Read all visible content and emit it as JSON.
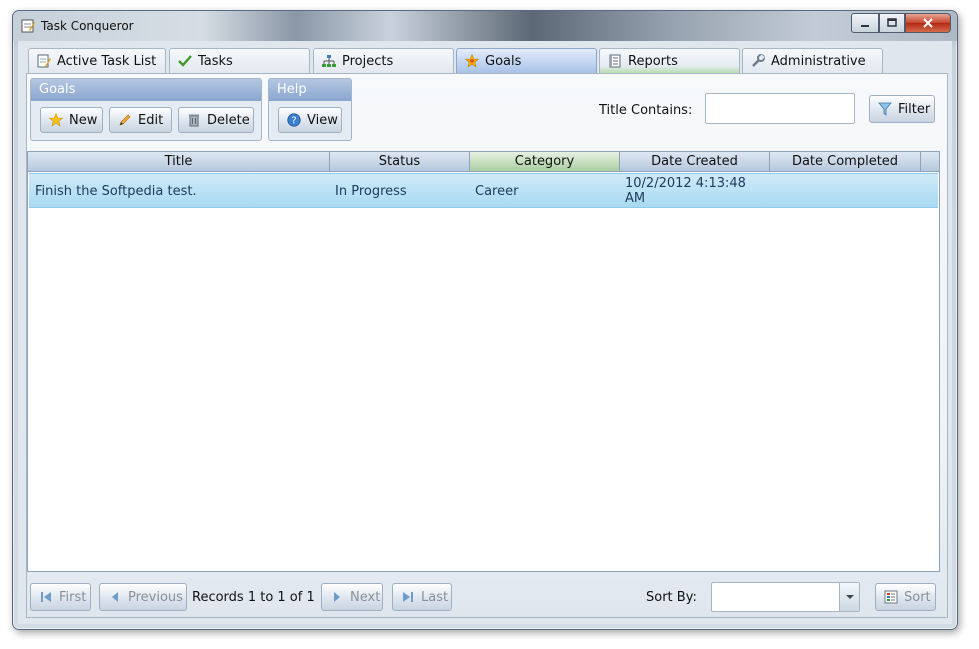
{
  "window": {
    "title": "Task Conqueror"
  },
  "tabs": [
    {
      "label": "Active Task List",
      "icon": "notepad-icon"
    },
    {
      "label": "Tasks",
      "icon": "checkmark-icon"
    },
    {
      "label": "Projects",
      "icon": "hierarchy-icon"
    },
    {
      "label": "Goals",
      "icon": "goal-star-icon",
      "active": true
    },
    {
      "label": "Reports",
      "icon": "report-icon"
    },
    {
      "label": "Administrative",
      "icon": "wrench-icon"
    }
  ],
  "toolbar": {
    "goals_group": "Goals",
    "new_label": "New",
    "edit_label": "Edit",
    "delete_label": "Delete",
    "help_group": "Help",
    "view_label": "View"
  },
  "filter": {
    "title_label": "Title Contains:",
    "value": "",
    "button_label": "Filter"
  },
  "grid": {
    "columns": [
      "Title",
      "Status",
      "Category",
      "Date Created",
      "Date Completed"
    ],
    "sorted_column": "Category",
    "rows": [
      {
        "title": "Finish the Softpedia test.",
        "status": "In Progress",
        "category": "Career",
        "date_created": "10/2/2012 4:13:48 AM",
        "date_completed": ""
      }
    ]
  },
  "pager": {
    "first_label": "First",
    "previous_label": "Previous",
    "records_text": "Records 1 to 1 of 1",
    "next_label": "Next",
    "last_label": "Last"
  },
  "sort": {
    "label": "Sort By:",
    "value": "",
    "button_label": "Sort"
  },
  "colors": {
    "accent": "#8aa6cf",
    "selected_row": "#a8daf2",
    "sorted_header": "#a9cfa0"
  }
}
